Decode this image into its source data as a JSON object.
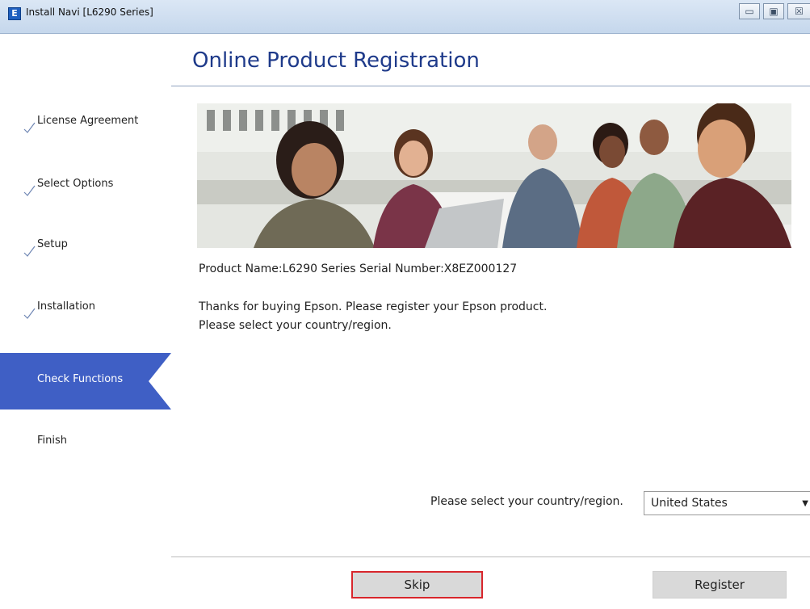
{
  "window": {
    "title": "Install Navi [L6290 Series]",
    "app_icon_letter": "E",
    "minimize_glyph": "▭",
    "maximize_glyph": "▣",
    "close_glyph": "☒"
  },
  "sidebar": {
    "steps": [
      {
        "label": "License Agreement",
        "completed": true,
        "active": false
      },
      {
        "label": "Select Options",
        "completed": true,
        "active": false
      },
      {
        "label": "Setup",
        "completed": true,
        "active": false
      },
      {
        "label": "Installation",
        "completed": true,
        "active": false
      },
      {
        "label": "Check Functions",
        "completed": false,
        "active": true
      },
      {
        "label": "Finish",
        "completed": false,
        "active": false
      }
    ],
    "active_color": "#3f5fc5"
  },
  "main": {
    "title": "Online Product Registration",
    "product_info": "Product Name:L6290 Series Serial Number:X8EZ000127",
    "thanks_line": "Thanks for buying Epson. Please register your Epson product.",
    "select_prompt": "Please select your country/region.",
    "country": {
      "label": "Please select your country/region.",
      "selected": "United States"
    }
  },
  "buttons": {
    "skip_label": "Skip",
    "register_label": "Register",
    "highlight_color": "#d8262c"
  },
  "colors": {
    "title_color": "#1e3a8a"
  }
}
